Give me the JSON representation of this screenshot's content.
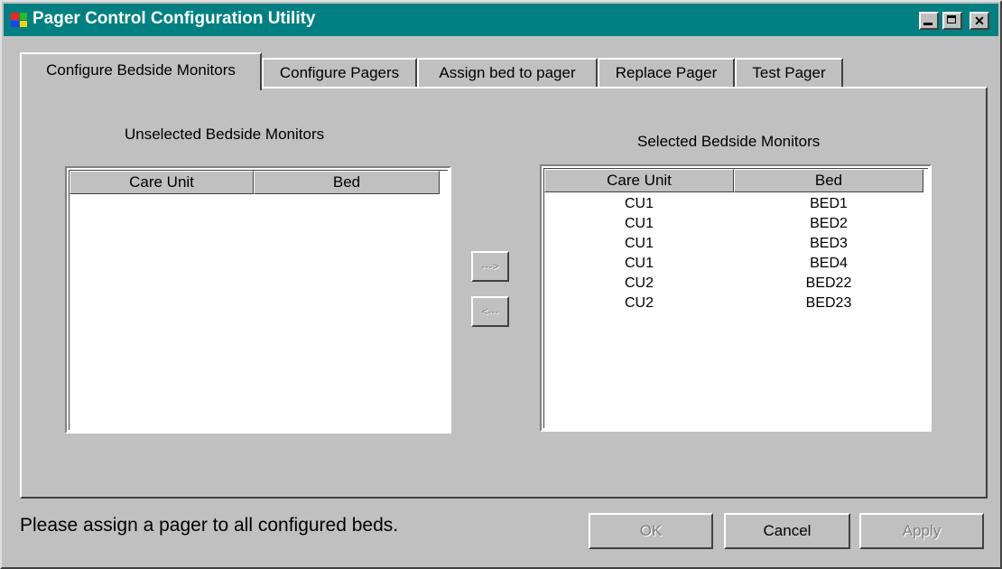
{
  "window": {
    "title": "Pager Control Configuration Utility"
  },
  "tabs": [
    {
      "label": "Configure Bedside Monitors",
      "active": true
    },
    {
      "label": "Configure Pagers",
      "active": false
    },
    {
      "label": "Assign bed to pager",
      "active": false
    },
    {
      "label": "Replace Pager",
      "active": false
    },
    {
      "label": "Test Pager",
      "active": false
    }
  ],
  "unselected": {
    "label": "Unselected Bedside Monitors",
    "columns": [
      "Care Unit",
      "Bed"
    ],
    "rows": []
  },
  "selected": {
    "label": "Selected Bedside Monitors",
    "columns": [
      "Care Unit",
      "Bed"
    ],
    "rows": [
      [
        "CU1",
        "BED1"
      ],
      [
        "CU1",
        "BED2"
      ],
      [
        "CU1",
        "BED3"
      ],
      [
        "CU1",
        "BED4"
      ],
      [
        "CU2",
        "BED22"
      ],
      [
        "CU2",
        "BED23"
      ]
    ]
  },
  "transfer": {
    "add_label": "--->",
    "remove_label": "<---"
  },
  "footer": {
    "status": "Please assign a pager to all configured beds.",
    "ok_label": "OK",
    "cancel_label": "Cancel",
    "apply_label": "Apply"
  }
}
